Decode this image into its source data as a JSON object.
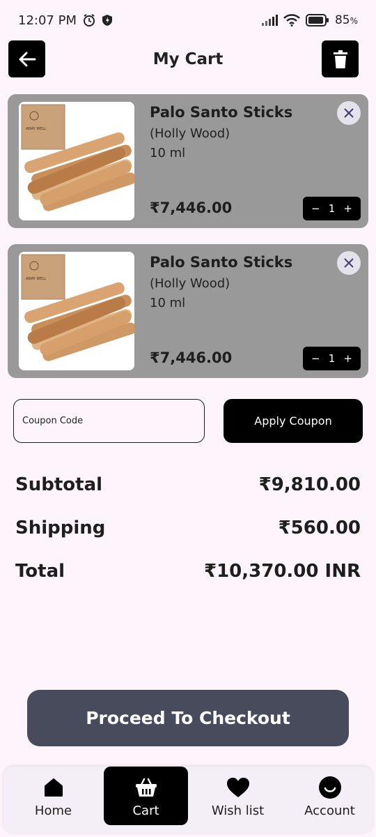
{
  "status_bar": {
    "time": "12:07 PM",
    "battery": "85"
  },
  "header": {
    "title": "My Cart"
  },
  "cart_items": [
    {
      "name": "Palo Santo Sticks",
      "variant": "(Holly Wood)",
      "size": "10 ml",
      "price": "₹7,446.00",
      "quantity": "1",
      "minus": "−",
      "plus": "+",
      "remove_icon": "close-icon",
      "box_brand": "AWAY WELL"
    },
    {
      "name": "Palo Santo Sticks",
      "variant": "(Holly Wood)",
      "size": "10 ml",
      "price": "₹7,446.00",
      "quantity": "1",
      "minus": "−",
      "plus": "+",
      "remove_icon": "close-icon",
      "box_brand": "AWAY WELL"
    }
  ],
  "coupon": {
    "placeholder": "Coupon Code",
    "value": "",
    "apply_label": "Apply Coupon"
  },
  "summary": {
    "subtotal_label": "Subtotal",
    "subtotal_value": "₹9,810.00",
    "shipping_label": "Shipping",
    "shipping_value": "₹560.00",
    "total_label": "Total",
    "total_value": "₹10,370.00 INR"
  },
  "checkout_label": "Proceed To Checkout",
  "bottom_nav": {
    "items": [
      {
        "label": "Home",
        "icon": "home-icon"
      },
      {
        "label": "Cart",
        "icon": "basket-icon"
      },
      {
        "label": "Wish list",
        "icon": "heart-icon"
      },
      {
        "label": "Account",
        "icon": "smiley-icon"
      }
    ],
    "active_index": 1
  },
  "colors": {
    "background": "#fdf5fb",
    "card": "#999999",
    "checkout": "#474b5c",
    "black": "#000000",
    "remove_x": "#3f3a78"
  }
}
